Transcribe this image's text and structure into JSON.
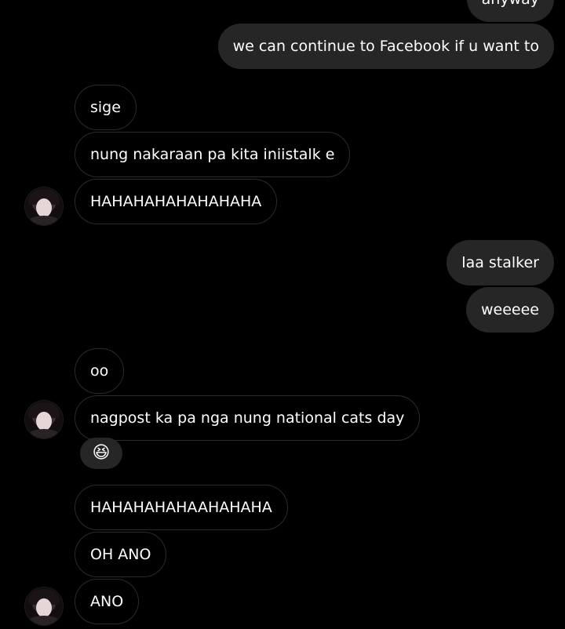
{
  "messages": [
    {
      "text": "anyway",
      "side": "out"
    },
    {
      "text": "we can continue to Facebook if u want to",
      "side": "out"
    },
    {
      "text": "sige",
      "side": "in"
    },
    {
      "text": "nung nakaraan pa kita iniistalk e",
      "side": "in"
    },
    {
      "text": "HAHAHAHAHAHAHAHA",
      "side": "in"
    },
    {
      "text": "laa stalker",
      "side": "out"
    },
    {
      "text": "weeeee",
      "side": "out"
    },
    {
      "text": "oo",
      "side": "in"
    },
    {
      "text": "nagpost ka pa nga nung national cats day",
      "side": "in"
    },
    {
      "text": "HAHAHAHAHAAHAHAHA",
      "side": "in"
    },
    {
      "text": "OH ANO",
      "side": "in"
    },
    {
      "text": "ANO",
      "side": "in"
    }
  ],
  "reaction": {
    "emoji": "😆"
  },
  "colors": {
    "background": "#000000",
    "outgoing_bubble": "#262626",
    "incoming_border": "#2b2b2b",
    "text": "#ffffff"
  }
}
